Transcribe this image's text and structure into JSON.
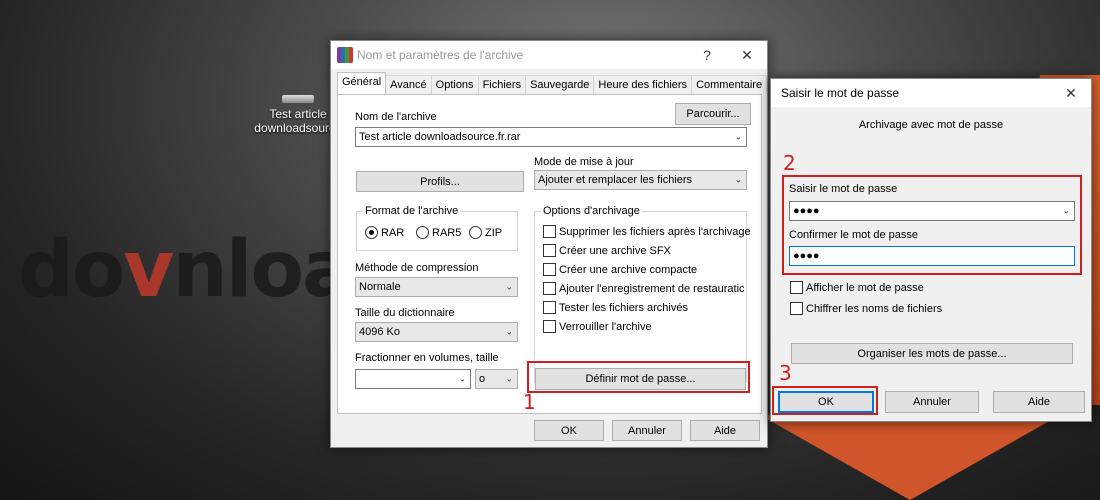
{
  "desktop": {
    "icon_label_1": "Test article",
    "icon_label_2": "downloadsource",
    "logo_text_1": "do",
    "logo_text_2": "v",
    "logo_text_3": "nloa"
  },
  "archive_window": {
    "title": "Nom et paramètres de l'archive",
    "help_label": "?",
    "close_label": "✕",
    "tabs": [
      "Général",
      "Avancé",
      "Options",
      "Fichiers",
      "Sauvegarde",
      "Heure des fichiers",
      "Commentaire"
    ],
    "archive_name_label": "Nom de l'archive",
    "browse_label": "Parcourir...",
    "archive_name_value": "Test article downloadsource.fr.rar",
    "update_mode_label": "Mode de mise à jour",
    "profiles_label": "Profils...",
    "update_mode_value": "Ajouter et remplacer les fichiers",
    "format_group_title": "Format de l'archive",
    "format_options": [
      "RAR",
      "RAR5",
      "ZIP"
    ],
    "options_group_title": "Options d'archivage",
    "options": [
      "Supprimer les fichiers après l'archivage",
      "Créer une archive SFX",
      "Créer une archive compacte",
      "Ajouter l'enregistrement de restauratic",
      "Tester les fichiers archivés",
      "Verrouiller l'archive"
    ],
    "compression_label": "Méthode de compression",
    "compression_value": "Normale",
    "dictionary_label": "Taille du dictionnaire",
    "dictionary_value": "4096 Ko",
    "split_label": "Fractionner en volumes, taille",
    "split_value": "",
    "split_unit": "o",
    "set_password_label": "Définir mot de passe...",
    "ok_label": "OK",
    "cancel_label": "Annuler",
    "help_button_label": "Aide"
  },
  "password_window": {
    "title": "Saisir le mot de passe",
    "close_label": "✕",
    "subtitle": "Archivage avec mot de passe",
    "enter_label": "Saisir le mot de passe",
    "enter_value": "●●●●",
    "confirm_label": "Confirmer le mot de passe",
    "confirm_value": "●●●●",
    "show_password_label": "Afficher le mot de passe",
    "encrypt_names_label": "Chiffrer les noms de fichiers",
    "organize_label": "Organiser les mots de passe...",
    "ok_label": "OK",
    "cancel_label": "Annuler",
    "help_label": "Aide"
  },
  "annotations": {
    "step1": "1",
    "step2": "2",
    "step3": "3",
    "color": "#d0201e"
  }
}
